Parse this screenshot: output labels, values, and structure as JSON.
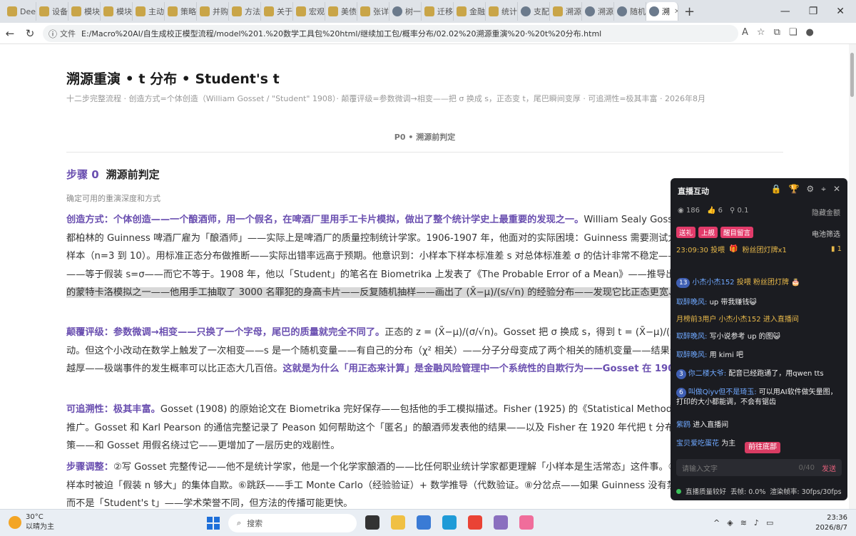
{
  "browser": {
    "tabs": [
      {
        "label": "Deep",
        "icon": "deepseek-icon"
      },
      {
        "label": "设备",
        "icon": "doc-icon"
      },
      {
        "label": "模块",
        "icon": "doc-icon"
      },
      {
        "label": "模块",
        "icon": "doc-icon"
      },
      {
        "label": "主动",
        "icon": "doc-icon"
      },
      {
        "label": "策略",
        "icon": "doc-icon"
      },
      {
        "label": "并购",
        "icon": "doc-icon"
      },
      {
        "label": "方法",
        "icon": "doc-icon"
      },
      {
        "label": "关于",
        "icon": "doc-icon"
      },
      {
        "label": "宏观",
        "icon": "doc-icon"
      },
      {
        "label": "美债",
        "icon": "github-icon"
      },
      {
        "label": "张详",
        "icon": "doc-icon"
      },
      {
        "label": "树一",
        "icon": "globe-icon"
      },
      {
        "label": "迁移",
        "icon": "doc-icon"
      },
      {
        "label": "金融",
        "icon": "doc-icon"
      },
      {
        "label": "统计",
        "icon": "doc-icon"
      },
      {
        "label": "支配",
        "icon": "globe-icon"
      },
      {
        "label": "溯源",
        "icon": "doc-icon"
      },
      {
        "label": "溯源",
        "icon": "globe-icon"
      },
      {
        "label": "随机",
        "icon": "globe-icon"
      },
      {
        "label": "溯",
        "icon": "globe-icon"
      }
    ],
    "new_tab": "+",
    "file_label": "文件",
    "url": "E:/Macro%20AI/自生成校正模型流程/model%201.%20数学工具包%20html/继续加工包/概率分布/02.02%20溯源重演%20·%20t%20分布.html"
  },
  "doc": {
    "title": "溯源重演 • t 分布 • Student's t",
    "subtitle": "十二步完整流程 · 创造方式=个体创造（William Gosset / \"Student\" 1908）· 颠覆评级=参数微调→相变——把 σ 换成 s，正态变 t，尾巴瞬间变厚 · 可追溯性=极其丰富 · 2026年8月",
    "section": "P0 • 溯源前判定",
    "step_num": "步骤 0",
    "step_title": "溯源前判定",
    "step_desc": "确定可用的重演深度和方式",
    "p1_key": "创造方式：个体创造——一个酿酒师，用一个假名，在啤酒厂里用手工卡片模拟，做出了整个统计学史上最重要的发现之一。",
    "p1_a": "William Sealy Gosset——牛津大学化学系的毕业生——1899 年被都柏林的 Guinness 啤酒厂雇为「酿酒师」——实际上是啤酒厂的质量控制统计学家。1906-1907 年，他面对的实际困境：Guinness 需要测试大麦和啤酒花的品质——但每次只能取极少量的样本（n=3 到 10）。用标准正态分布做推断——实际出错率远高于预期。他意识到：小样本下样本标准差 s 对总体标准差 σ 的估计非常不稳定——把分母中这个额外的不确定性丢进正态分布——等于假装 s=σ——而它不等于。1908 年，他以「Student」的笔名在 Biometrika 上发表了《The Probable Error of a Mean》——推导出了 t 分布——",
    "p1_hl": "并附上了可能是人类历史上最早的蒙特卡洛模拟之一——他用手工抽取了 3000 名罪犯的身高卡片——反复随机抽样——画出了 (X̄−μ)/(s/√n) 的经验分布——发现它比正态更宽、尾巴更厚。",
    "p2_key": "颠覆评级：参数微调→相变——只换了一个字母，尾巴的质量就完全不同了。",
    "p2_a": "正态的 z = (X̄−μ)/(σ/√n)。Gosset 把 σ 换成 s，得到 t = (X̄−μ)/(s/√n)——好像只是「用估计值代替真值」的小改动。但这个小改动在数学上触发了一次相变——s 是一个随机变量——有自己的分布（χ² 相关）——分子分母变成了两个相关的随机变量——结果分布的尾巴比正态厚得多——而且 n 越小，尾巴越厚——极端事件的发生概率可以比正态大几百倍。",
    "p2_key2": "这就是为什么「用正态来计算」是金融风险管理中一个系统性的自欺行为——Gosset 在 1908 年用啤酒样本就已经证明了。",
    "p3_key": "可追溯性：极其丰富。",
    "p3_a": "Gosset (1908) 的原始论文在 Biometrika 完好保存——包括他的手工模拟描述。Fisher (1925) 的《Statistical Methods for Research Workers》将 t 分布系统化和推广。Gosset 和 Karl Pearson 的通信完整记录了 Peason 如何帮助这个「匿名」的酿酒师发表他的结果——以及 Fisher 在 1920 年代把 t 分布变成了小样本推断的基石。Guinness 的禁发政策——和 Gosset 用假名绕过它——更增加了一层历史的戏剧性。",
    "p4_key": "步骤调整：",
    "p4_a": "②写 Gosset 完整传记——他不是统计学家，他是一个化学家酿酒的——比任何职业统计学家都更理解「小样本是生活常态」这件事。④ Gosset 个人的死路——而是工业实践面对小样本时被迫「假装 n 够大」的集体自欺。⑥跳跃——手工 Monte Carlo（经验验证）+ 数学推导（代数验证。⑧分岔点——如果 Guinness 没有禁发政策，他可能用真名发表——「Gosset's t」而不是「Student's t」——学术荣誉不同，但方法的传播可能更快。"
  },
  "live_panel": {
    "title": "直播互动",
    "views": "186",
    "likes": "6",
    "coins": "0.1",
    "hide_amount": "隐藏金额",
    "tags": [
      "送礼",
      "上舰",
      "醒目留言"
    ],
    "filter": "电池筛选",
    "gift_time": "23:09:30 投喂",
    "gift_name": "粉丝团灯牌x1",
    "gift_count": "1",
    "messages": [
      {
        "badge": "13",
        "user": "小杰小杰152",
        "text": "投喂 粉丝团灯牌 🎂",
        "type": "gift"
      },
      {
        "badge": "",
        "user": "取醉晚风:",
        "text": "up 带我赚钱😺",
        "type": "chat"
      },
      {
        "badge": "",
        "user": "月榜前3用户 小杰小杰152",
        "text": "进入直播间",
        "type": "enter"
      },
      {
        "badge": "",
        "user": "取醉晚风:",
        "text": "写小说参考 up 的图😺",
        "type": "chat"
      },
      {
        "badge": "",
        "user": "取醉晚风:",
        "text": "用 kimi 吧",
        "type": "chat"
      },
      {
        "badge": "3",
        "user": "你二楼大爷:",
        "text": "配音已经跑通了，用qwen tts",
        "type": "chat"
      },
      {
        "badge": "6",
        "user": "叫做Qiyv但不是琦玉:",
        "text": "可以用AI软件做矢量图，打印的大小都能调，不会有锯齿",
        "type": "chat"
      },
      {
        "badge": "",
        "user": "紫鸥",
        "text": "进入直播间",
        "type": "chat"
      },
      {
        "badge": "",
        "user": "宝贝爱吃蛋花",
        "text": "为主",
        "type": "chat"
      }
    ],
    "goto_bottom": "前往底部",
    "input_placeholder": "请输入文字",
    "input_count": "0/40",
    "send": "发送",
    "status": "直播质量较好",
    "loss": "丢帧: 0.0%",
    "fps": "渲染帧率: 30fps/30fps"
  },
  "taskbar": {
    "temp": "30°C",
    "weather": "以晴为主",
    "search": "搜索",
    "time": "23:36",
    "date": "2026/8/7"
  }
}
